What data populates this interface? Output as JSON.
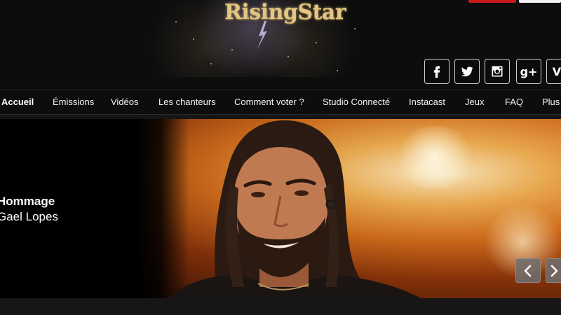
{
  "header": {
    "logo_text": "RisingStar",
    "social_links": [
      {
        "name": "facebook-icon"
      },
      {
        "name": "twitter-icon"
      },
      {
        "name": "instagram-icon"
      },
      {
        "name": "google-plus-icon",
        "label": "g+"
      },
      {
        "name": "vine-icon",
        "label": "V"
      }
    ]
  },
  "nav": {
    "items": [
      {
        "label": "Accueil",
        "active": true
      },
      {
        "label": "Émissions"
      },
      {
        "label": "Vidéos"
      },
      {
        "label": "Les chanteurs"
      },
      {
        "label": "Comment voter ?"
      },
      {
        "label": "Studio Connecté"
      },
      {
        "label": "Instacast"
      },
      {
        "label": "Jeux"
      },
      {
        "label": "FAQ"
      },
      {
        "label": "Plus"
      }
    ]
  },
  "hero": {
    "title": "Hommage",
    "subtitle": "Gael Lopes",
    "prev_icon": "chevron-left-icon",
    "next_icon": "chevron-right-icon"
  },
  "colors": {
    "background": "#0d0d0d",
    "logo_gold": "#e3c685",
    "topbar_red": "#c91a1a"
  }
}
